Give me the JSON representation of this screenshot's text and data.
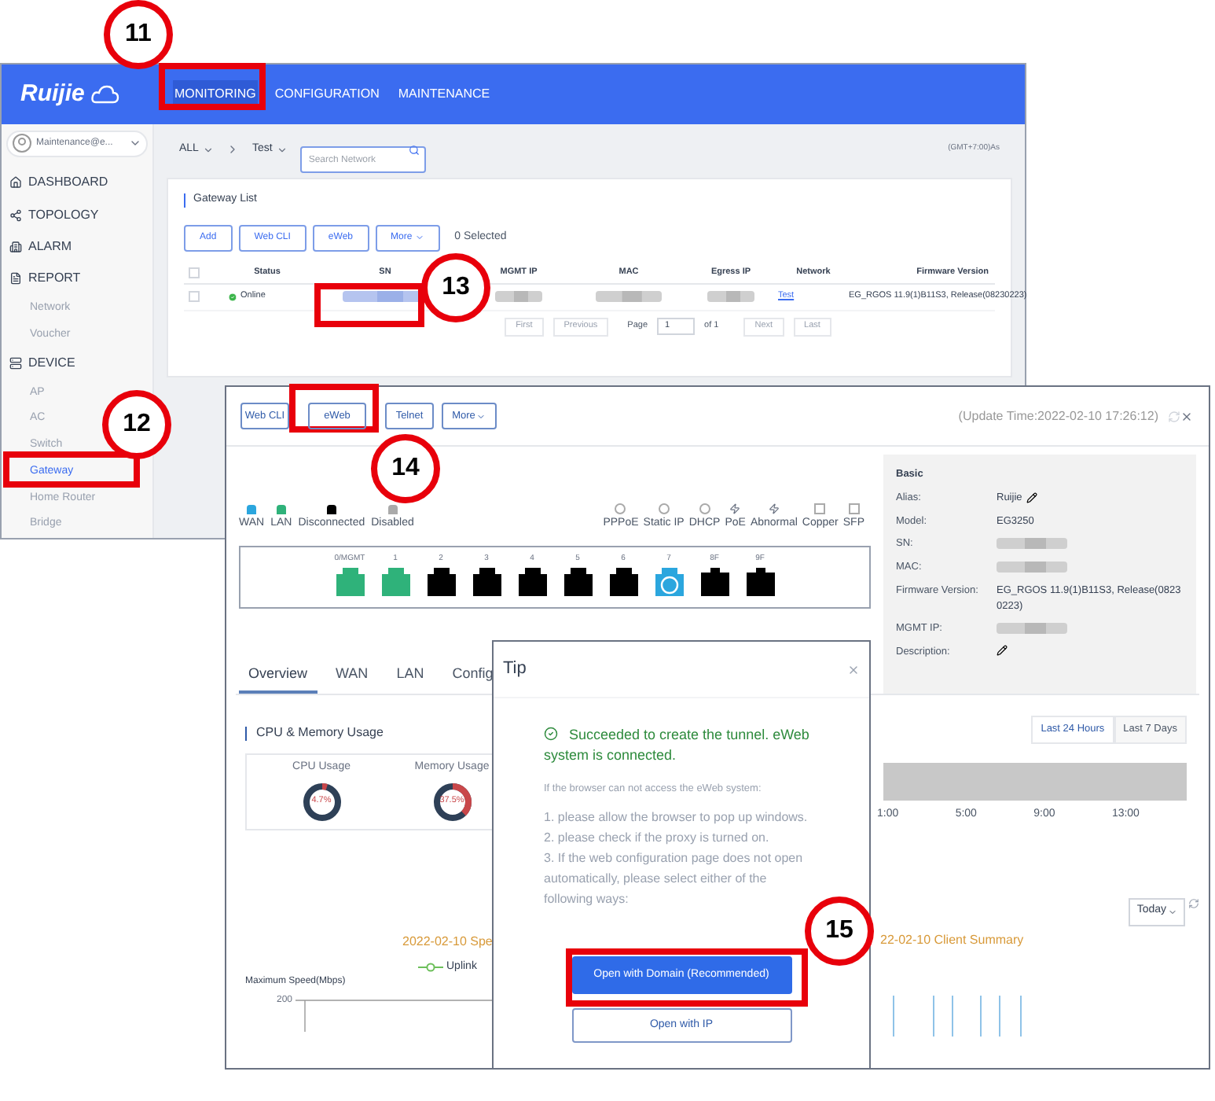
{
  "callouts": [
    {
      "label": "11"
    },
    {
      "label": "13"
    },
    {
      "label": "12"
    },
    {
      "label": "14"
    },
    {
      "label": "15"
    }
  ],
  "cloud_window": {
    "logo": "Ruijie",
    "nav": [
      {
        "label": "MONITORING",
        "selected": true
      },
      {
        "label": "CONFIGURATION",
        "selected": false
      },
      {
        "label": "MAINTENANCE",
        "selected": false
      }
    ],
    "user": "Maintenance@e...",
    "sidebar": [
      {
        "label": "DASHBOARD",
        "selected": false
      },
      {
        "label": "TOPOLOGY",
        "selected": false
      },
      {
        "label": "ALARM",
        "selected": false
      },
      {
        "label": "REPORT",
        "selected": false,
        "children": [
          {
            "label": "Network",
            "selected": false
          },
          {
            "label": "Voucher",
            "selected": false
          }
        ]
      },
      {
        "label": "DEVICE",
        "selected": false,
        "children": [
          {
            "label": "AP",
            "selected": false
          },
          {
            "label": "AC",
            "selected": false
          },
          {
            "label": "Switch",
            "selected": false
          },
          {
            "label": "Gateway",
            "selected": true
          },
          {
            "label": "Home Router",
            "selected": false
          },
          {
            "label": "Bridge",
            "selected": false
          }
        ]
      }
    ],
    "breadcrumb": [
      "ALL",
      "Test"
    ],
    "search": {
      "placeholder": "Search Network"
    },
    "timezone": "(GMT+7:00)As",
    "gateway_list": {
      "title": "Gateway List",
      "buttons": [
        "Add",
        "Web CLI",
        "eWeb",
        "More"
      ],
      "selected_count": "0 Selected",
      "header_checked": false,
      "columns": [
        "Status",
        "SN",
        "MGMT IP",
        "MAC",
        "Egress IP",
        "Network",
        "Firmware Version"
      ],
      "rows": [
        {
          "checked": false,
          "status": "Online",
          "network": "Test",
          "firmware": "EG_RGOS 11.9(1)B11S3, Release(08230223)"
        }
      ],
      "pagination": {
        "first": "First",
        "previous": "Previous",
        "page_label": "Page",
        "page": "1",
        "of": "of 1",
        "next": "Next",
        "last": "Last"
      }
    }
  },
  "device_window": {
    "toolbar": [
      "Web CLI",
      "eWeb",
      "Telnet",
      "More"
    ],
    "update_time": "(Update Time:2022-02-10 17:26:12)",
    "legend": [
      {
        "label": "WAN",
        "color": "#2ba6de"
      },
      {
        "label": "LAN",
        "color": "#2fb27a"
      },
      {
        "label": "Disconnected",
        "color": "#000000"
      },
      {
        "label": "Disabled",
        "color": "#aaaaaa"
      }
    ],
    "features": [
      "PPPoE",
      "Static IP",
      "DHCP",
      "PoE",
      "Abnormal",
      "Copper",
      "SFP"
    ],
    "ports": [
      {
        "label": "0/MGMT",
        "kind": "rj45",
        "color": "#2fb27a",
        "dhcp": false
      },
      {
        "label": "1",
        "kind": "rj45",
        "color": "#2fb27a",
        "dhcp": false
      },
      {
        "label": "2",
        "kind": "rj45",
        "color": "#000000",
        "dhcp": false
      },
      {
        "label": "3",
        "kind": "rj45",
        "color": "#000000",
        "dhcp": false
      },
      {
        "label": "4",
        "kind": "rj45",
        "color": "#000000",
        "dhcp": false
      },
      {
        "label": "5",
        "kind": "rj45",
        "color": "#000000",
        "dhcp": false
      },
      {
        "label": "6",
        "kind": "rj45",
        "color": "#000000",
        "dhcp": false
      },
      {
        "label": "7",
        "kind": "rj45",
        "color": "#2ba6de",
        "dhcp": true
      },
      {
        "label": "8F",
        "kind": "sfp",
        "color": "#000000",
        "dhcp": false
      },
      {
        "label": "9F",
        "kind": "sfp",
        "color": "#000000",
        "dhcp": false
      }
    ],
    "info": {
      "title": "Basic",
      "fields": [
        {
          "label": "Alias:",
          "value": "Ruijie",
          "kind": "editable"
        },
        {
          "label": "Model:",
          "value": "EG3250",
          "kind": "text"
        },
        {
          "label": "SN:",
          "kind": "blurred"
        },
        {
          "label": "MAC:",
          "kind": "blurred"
        },
        {
          "label": "Firmware Version:",
          "value": "EG_RGOS 11.9(1)B11S3, Release(08230223)",
          "kind": "text"
        },
        {
          "label": "MGMT IP:",
          "kind": "blurred"
        },
        {
          "label": "Description:",
          "kind": "editable"
        }
      ]
    },
    "tabs": [
      {
        "label": "Overview",
        "selected": true
      },
      {
        "label": "WAN",
        "selected": false
      },
      {
        "label": "LAN",
        "selected": false
      },
      {
        "label": "Config",
        "selected": false
      }
    ],
    "usage": {
      "title": "CPU & Memory Usage",
      "gauges": [
        {
          "label": "CPU Usage",
          "value": "4.7%",
          "level": 0.047
        },
        {
          "label": "Memory Usage",
          "value": "37.5%",
          "level": 0.375
        }
      ]
    },
    "ranges": [
      {
        "label": "Last 24 Hours",
        "selected": true
      },
      {
        "label": "Last 7 Days",
        "selected": false
      }
    ],
    "time_labels": [
      "1:00",
      "5:00",
      "9:00",
      "13:00"
    ],
    "period": "Today",
    "speed_chart": {
      "title": "2022-02-10 Spe",
      "legend": "Uplink",
      "ylabel": "Maximum Speed(Mbps)",
      "ytick": "200"
    },
    "client_chart": {
      "title": "22-02-10 Client Summary"
    }
  },
  "dialog": {
    "title": "Tip",
    "message": "Succeeded to create the tunnel. eWeb system is connected.",
    "intro": "If the browser can not access the eWeb system:",
    "steps": [
      "1. please allow the browser to pop up windows.",
      "2. please check if the proxy is turned on.",
      "3. If the web configuration page does not open automatically, please select either of the following ways:"
    ],
    "buttons": [
      {
        "label": "Open with Domain (Recommended)",
        "kind": "primary"
      },
      {
        "label": "Open with IP",
        "kind": "secondary"
      }
    ]
  }
}
